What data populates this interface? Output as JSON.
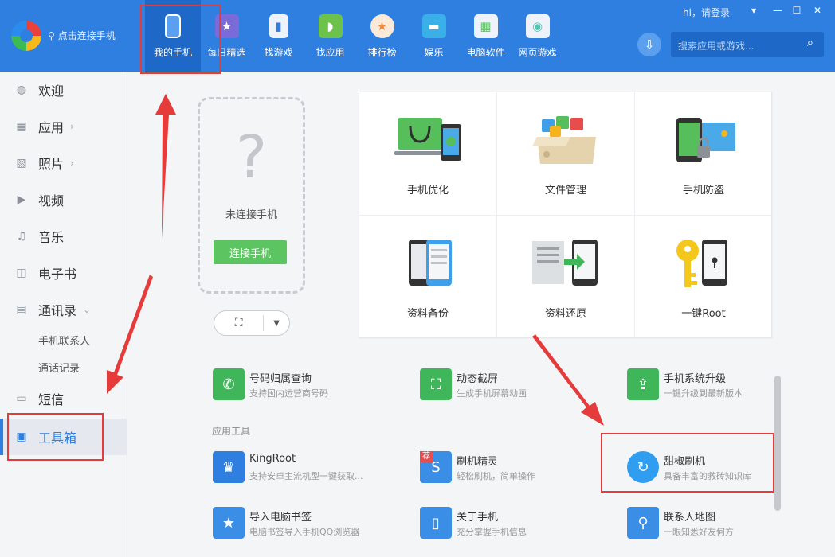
{
  "header": {
    "connect_text": "点击连接手机",
    "user_text": "hi，请登录",
    "search_placeholder": "搜索应用或游戏...",
    "nav": [
      {
        "label": "我的手机",
        "icon": "phone-icon",
        "color": "#5aa0ee"
      },
      {
        "label": "每日精选",
        "icon": "calendar-star-icon",
        "color": "#7b6bd9"
      },
      {
        "label": "找游戏",
        "icon": "gamepad-icon",
        "color": "#eef3fb"
      },
      {
        "label": "找应用",
        "icon": "android-bag-icon",
        "color": "#6cc24a"
      },
      {
        "label": "排行榜",
        "icon": "medal-icon",
        "color": "#f08a3c"
      },
      {
        "label": "娱乐",
        "icon": "entertainment-icon",
        "color": "#3ab0e8"
      },
      {
        "label": "电脑软件",
        "icon": "monitor-icon",
        "color": "#5cc460"
      },
      {
        "label": "网页游戏",
        "icon": "browser-game-icon",
        "color": "#4fc9b0"
      }
    ]
  },
  "sidebar": {
    "items": [
      {
        "label": "欢迎",
        "icon": "welcome-icon"
      },
      {
        "label": "应用",
        "icon": "apps-grid-icon"
      },
      {
        "label": "照片",
        "icon": "photo-icon"
      },
      {
        "label": "视频",
        "icon": "video-icon"
      },
      {
        "label": "音乐",
        "icon": "music-icon"
      },
      {
        "label": "电子书",
        "icon": "book-icon"
      },
      {
        "label": "通讯录",
        "icon": "contacts-icon"
      },
      {
        "label": "短信",
        "icon": "message-icon"
      },
      {
        "label": "工具箱",
        "icon": "toolbox-icon"
      }
    ],
    "contacts_sub": [
      "手机联系人",
      "通话记录"
    ]
  },
  "phone_panel": {
    "question": "?",
    "status": "未连接手机",
    "connect_button": "连接手机"
  },
  "grid": [
    {
      "label": "手机优化"
    },
    {
      "label": "文件管理"
    },
    {
      "label": "手机防盗"
    },
    {
      "label": "资料备份"
    },
    {
      "label": "资料还原"
    },
    {
      "label": "一键Root"
    }
  ],
  "tools_top": [
    {
      "name": "号码归属查询",
      "desc": "支持国内运营商号码",
      "icon": "phone-query-icon",
      "color": "#3fb65a"
    },
    {
      "name": "动态截屏",
      "desc": "生成手机屏幕动画",
      "icon": "screen-capture-icon",
      "color": "#3fb65a"
    },
    {
      "name": "手机系统升级",
      "desc": "一键升级到最新版本",
      "icon": "system-upgrade-icon",
      "color": "#3fb65a"
    }
  ],
  "section_label": "应用工具",
  "tools_app": [
    {
      "name": "KingRoot",
      "desc": "支持安卓主流机型一键获取...",
      "icon": "crown-icon",
      "color": "#2f7fe0"
    },
    {
      "name": "刷机精灵",
      "desc": "轻松刷机，简单操作",
      "icon": "flash-sprite-icon",
      "color": "#3a8ee6",
      "badge": "荐"
    },
    {
      "name": "甜椒刷机",
      "desc": "具备丰富的救砖知识库",
      "icon": "pepper-flash-icon",
      "color": "#2f9df0"
    },
    {
      "name": "导入电脑书签",
      "desc": "电脑书签导入手机QQ浏览器",
      "icon": "bookmark-import-icon",
      "color": "#3a8ee6"
    },
    {
      "name": "关于手机",
      "desc": "充分掌握手机信息",
      "icon": "phone-info-icon",
      "color": "#3a8ee6"
    },
    {
      "name": "联系人地图",
      "desc": "一眼知悉好友何方",
      "icon": "contact-map-icon",
      "color": "#3a8ee6"
    }
  ]
}
